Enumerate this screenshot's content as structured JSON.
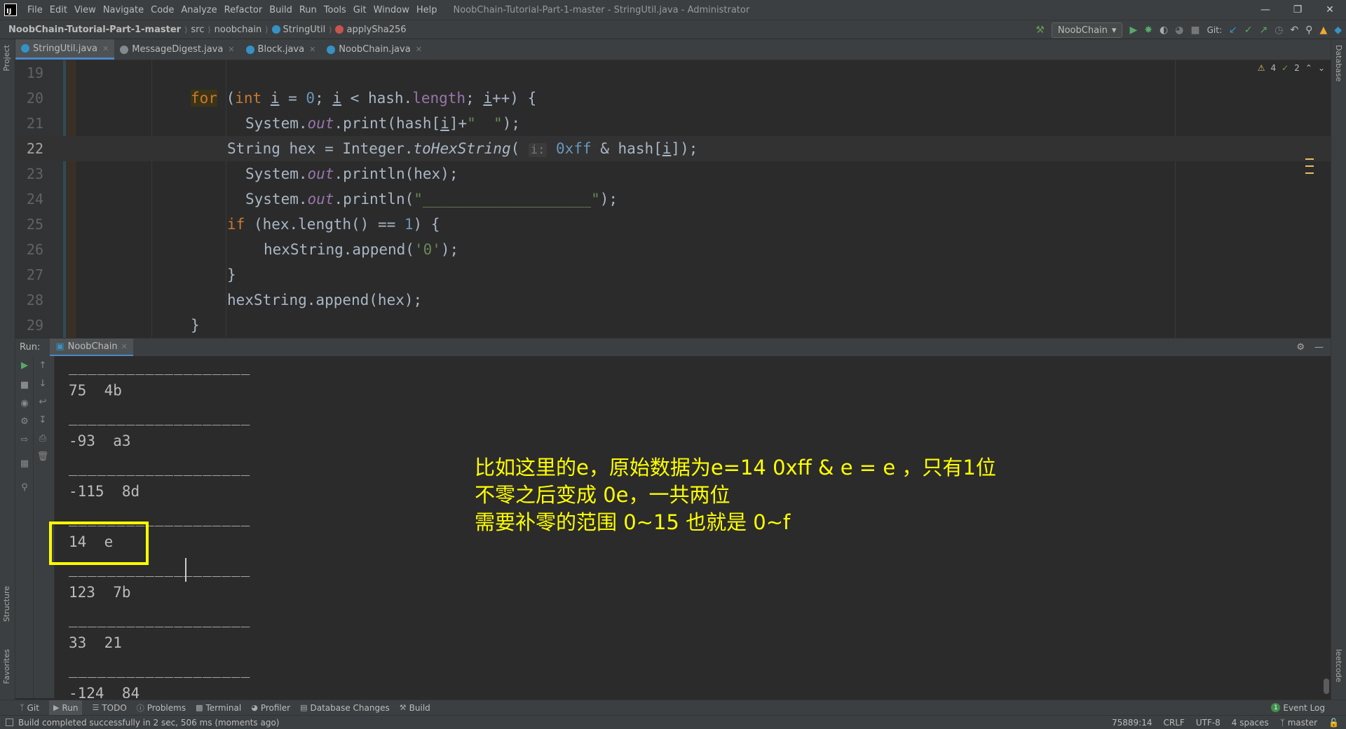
{
  "menubar": {
    "logo": "IJ",
    "items": [
      "File",
      "Edit",
      "View",
      "Navigate",
      "Code",
      "Analyze",
      "Refactor",
      "Build",
      "Run",
      "Tools",
      "Git",
      "Window",
      "Help"
    ],
    "title": "NoobChain-Tutorial-Part-1-master - StringUtil.java - Administrator"
  },
  "breadcrumb": {
    "project": "NoobChain-Tutorial-Part-1-master",
    "src": "src",
    "package": "noobchain",
    "class": "StringUtil",
    "method": "applySha256"
  },
  "navtools": {
    "run_config": "NoobChain",
    "git_label": "Git:"
  },
  "tabs": [
    {
      "label": "StringUtil.java",
      "active": true
    },
    {
      "label": "MessageDigest.java",
      "active": false
    },
    {
      "label": "Block.java",
      "active": false
    },
    {
      "label": "NoobChain.java",
      "active": false
    }
  ],
  "left_stripe": {
    "project": "Project",
    "structure": "Structure",
    "favorites": "Favorites"
  },
  "right_stripe": {
    "database": "Database",
    "leetcode": "leetcode"
  },
  "inspections": {
    "warnings": "4",
    "ok": "2"
  },
  "editor": {
    "line_numbers": [
      "19",
      "20",
      "21",
      "22",
      "23",
      "24",
      "25",
      "26",
      "27",
      "28",
      "29"
    ],
    "current_line": "22"
  },
  "run_panel": {
    "run_label": "Run:",
    "tab": "NoobChain",
    "separator": "___________________",
    "output": [
      {
        "dec": "75",
        "hex": "4b"
      },
      {
        "dec": "-93",
        "hex": "a3"
      },
      {
        "dec": "-115",
        "hex": "8d"
      },
      {
        "dec": "14",
        "hex": "e"
      },
      {
        "dec": "123",
        "hex": "7b"
      },
      {
        "dec": "33",
        "hex": "21"
      },
      {
        "dec": "-124",
        "hex": "84"
      }
    ],
    "annotation": {
      "line1": "比如这里的e，原始数据为e=14 0xff & e = e ，只有1位",
      "line2": "不零之后变成 0e，一共两位",
      "line3": "需要补零的范围 0~15 也就是 0~f"
    }
  },
  "bottom_tools": [
    "Git",
    "Run",
    "TODO",
    "Problems",
    "Terminal",
    "Profiler",
    "Database Changes",
    "Build"
  ],
  "event_log": {
    "badge": "1",
    "label": "Event Log"
  },
  "status": {
    "message": "Build completed successfully in 2 sec, 506 ms (moments ago)",
    "position": "75889:14",
    "line_ending": "CRLF",
    "encoding": "UTF-8",
    "indent": "4 spaces",
    "branch": "master"
  }
}
